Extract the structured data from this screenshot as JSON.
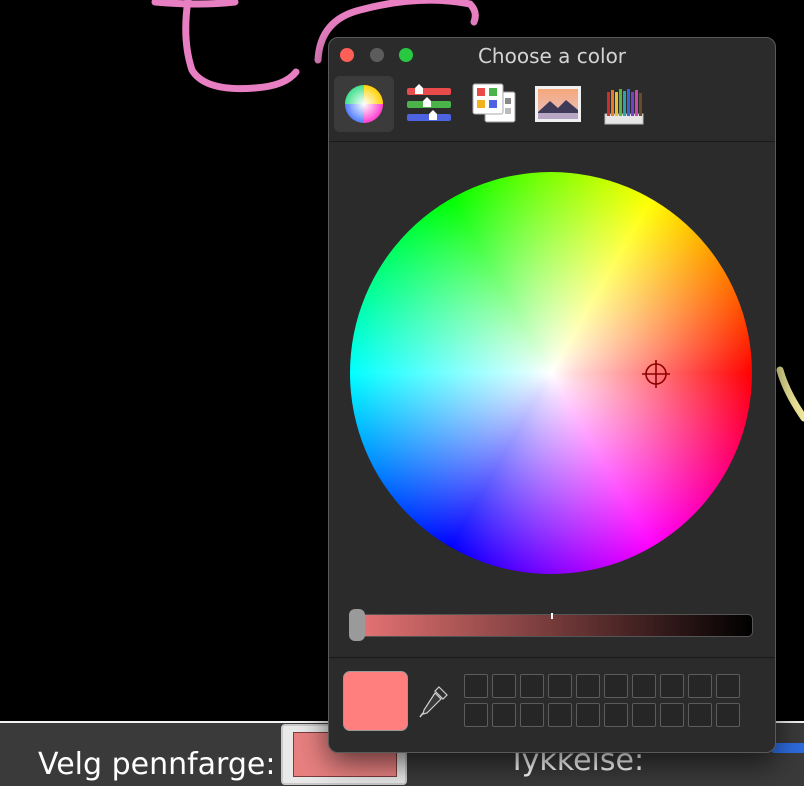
{
  "window": {
    "title": "Choose a color"
  },
  "toolbar": {
    "modes": [
      {
        "name": "color-wheel",
        "selected": true
      },
      {
        "name": "color-sliders",
        "selected": false
      },
      {
        "name": "color-palettes",
        "selected": false
      },
      {
        "name": "image-palettes",
        "selected": false
      },
      {
        "name": "pencils",
        "selected": false
      }
    ]
  },
  "color": {
    "current": "#ff7f7f",
    "brightness_gradient_start": "#e87474",
    "brightness_gradient_end": "#000000"
  },
  "custom_swatches": {
    "count": 20
  },
  "app": {
    "pen_color_label": "Velg pennfarge:",
    "pen_color": "#e88080",
    "thickness_label": "Tykkelse:"
  }
}
